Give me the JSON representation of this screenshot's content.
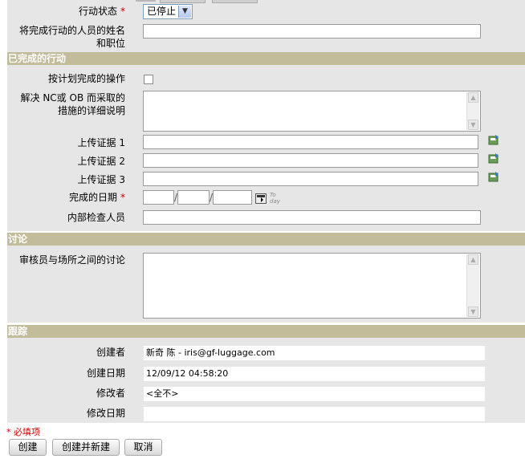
{
  "status": {
    "label": "行动状态",
    "req": "*",
    "value": "已停止"
  },
  "person": {
    "label": "将完成行动的人员的姓名和职位",
    "line1": "将完成行动的人员的姓名",
    "line2": "和职位",
    "value": ""
  },
  "completed": {
    "header": "已完成的行动",
    "planned": {
      "label": "按计划完成的操作",
      "checked": false
    },
    "measures": {
      "line1": "解决 NC或 OB 而采取的",
      "line2": "措施的详细说明",
      "value": ""
    },
    "upload1": {
      "label": "上传证据 1",
      "value": ""
    },
    "upload2": {
      "label": "上传证据 2",
      "value": ""
    },
    "upload3": {
      "label": "上传证据 3",
      "value": ""
    },
    "date": {
      "label": "完成的日期",
      "req": "*",
      "sep": "/",
      "month": "",
      "day": "",
      "year": "",
      "today_line1": "To",
      "today_line2": "day"
    },
    "inspector": {
      "label": "内部检查人员",
      "value": ""
    }
  },
  "discussion": {
    "header": "讨论",
    "label": "审核员与场所之间的讨论",
    "value": ""
  },
  "tracking": {
    "header": "跟踪",
    "creator": {
      "label": "创建者",
      "value": "新奇 陈 - iris@gf-luggage.com"
    },
    "created": {
      "label": "创建日期",
      "value": "12/09/12 04:58:20"
    },
    "modifier": {
      "label": "修改者",
      "value": "<全不>"
    },
    "modified": {
      "label": "修改日期",
      "value": ""
    }
  },
  "required_note": "* 必填项",
  "buttons": {
    "create": "创建",
    "create_new": "创建并新建",
    "cancel": "取消"
  },
  "colors": {
    "section_bg": "#c2bc9b",
    "panel_bg": "#e6e6e6",
    "required": "#cc0000"
  }
}
